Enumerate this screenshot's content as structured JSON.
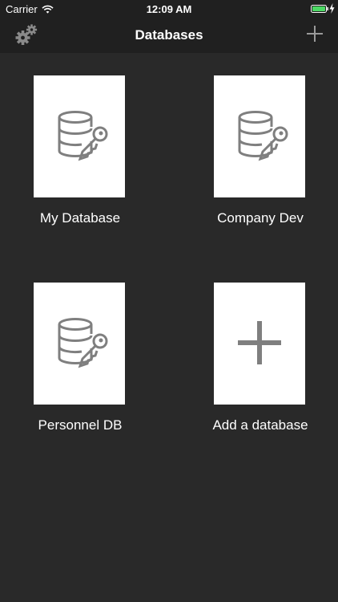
{
  "status_bar": {
    "carrier": "Carrier",
    "time": "12:09 AM"
  },
  "nav": {
    "title": "Databases",
    "left_icon": "gear-icon",
    "right_icon": "plus-icon"
  },
  "tiles": [
    {
      "label": "My Database",
      "icon": "database-key-icon"
    },
    {
      "label": "Company Dev",
      "icon": "database-key-icon"
    },
    {
      "label": "Personnel DB",
      "icon": "database-key-icon"
    },
    {
      "label": "Add a database",
      "icon": "plus-icon"
    }
  ],
  "colors": {
    "background": "#292929",
    "bar": "#202020",
    "card": "#ffffff",
    "icon_gray": "#7f7f7f",
    "battery_green": "#4cd964"
  }
}
